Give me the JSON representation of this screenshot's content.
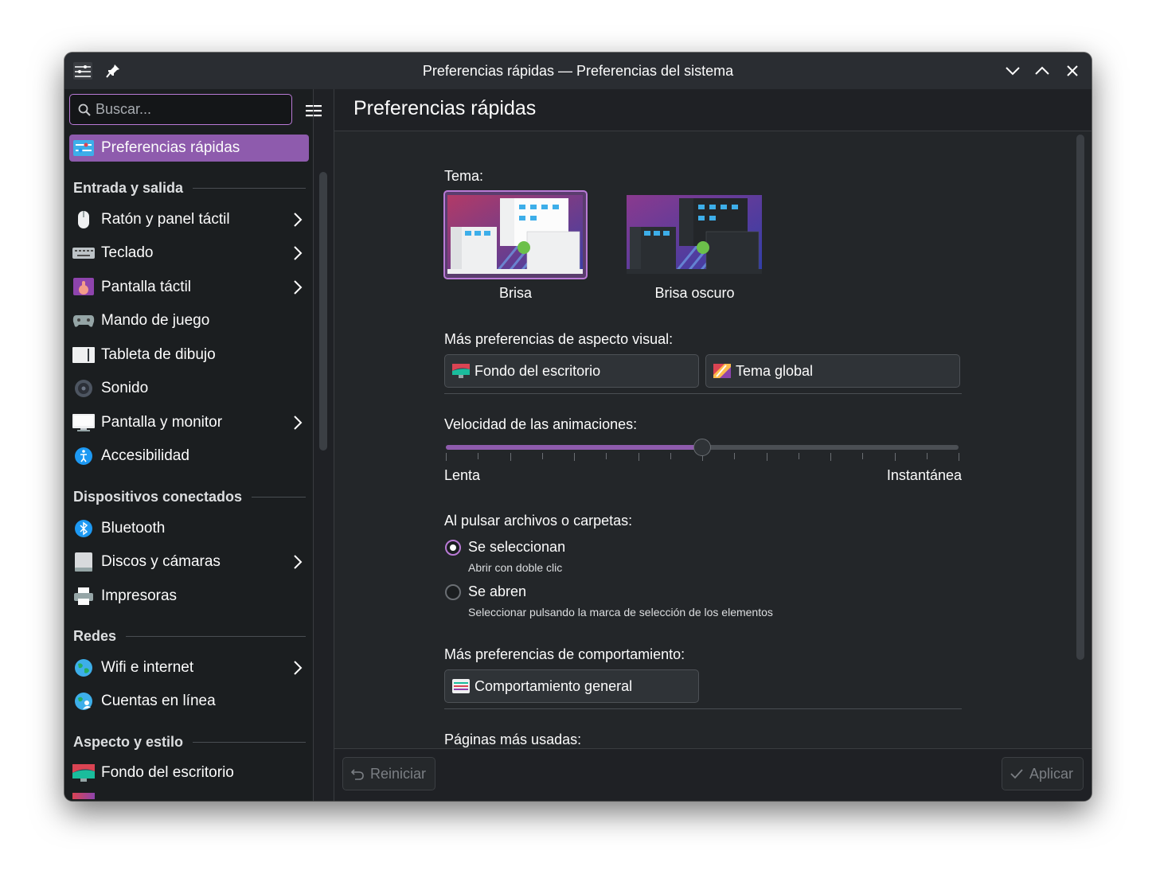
{
  "window": {
    "title": "Preferencias rápidas — Preferencias del sistema",
    "accent": "#8e5bad"
  },
  "search": {
    "placeholder": "Buscar..."
  },
  "sidebar": {
    "active": {
      "label": "Preferencias rápidas",
      "icon": "quick-settings-icon"
    },
    "sections": [
      {
        "title": "Entrada y salida",
        "items": [
          {
            "label": "Ratón y panel táctil",
            "icon": "mouse-icon",
            "chevron": true
          },
          {
            "label": "Teclado",
            "icon": "keyboard-icon",
            "chevron": true
          },
          {
            "label": "Pantalla táctil",
            "icon": "touchscreen-icon",
            "chevron": true
          },
          {
            "label": "Mando de juego",
            "icon": "gamepad-icon",
            "chevron": false
          },
          {
            "label": "Tableta de dibujo",
            "icon": "tablet-icon",
            "chevron": false
          },
          {
            "label": "Sonido",
            "icon": "speaker-icon",
            "chevron": false
          },
          {
            "label": "Pantalla y monitor",
            "icon": "monitor-icon",
            "chevron": true
          },
          {
            "label": "Accesibilidad",
            "icon": "accessibility-icon",
            "chevron": false
          }
        ]
      },
      {
        "title": "Dispositivos conectados",
        "items": [
          {
            "label": "Bluetooth",
            "icon": "bluetooth-icon",
            "chevron": false
          },
          {
            "label": "Discos y cámaras",
            "icon": "disk-icon",
            "chevron": true
          },
          {
            "label": "Impresoras",
            "icon": "printer-icon",
            "chevron": false
          }
        ]
      },
      {
        "title": "Redes",
        "items": [
          {
            "label": "Wifi e internet",
            "icon": "globe-icon",
            "chevron": true
          },
          {
            "label": "Cuentas en línea",
            "icon": "online-accounts-icon",
            "chevron": false
          }
        ]
      },
      {
        "title": "Aspecto y estilo",
        "items": [
          {
            "label": "Fondo del escritorio",
            "icon": "wallpaper-icon",
            "chevron": false
          }
        ]
      }
    ]
  },
  "main": {
    "title": "Preferencias rápidas",
    "theme": {
      "label": "Tema:",
      "options": [
        {
          "name": "Brisa",
          "selected": true
        },
        {
          "name": "Brisa oscuro",
          "selected": false
        }
      ]
    },
    "appearance": {
      "label": "Más preferencias de aspecto visual:",
      "buttons": [
        "Fondo del escritorio",
        "Tema global"
      ]
    },
    "animation": {
      "label": "Velocidad de las animaciones:",
      "min_label": "Lenta",
      "max_label": "Instantánea",
      "value_fraction": 0.5,
      "ticks": 17
    },
    "click": {
      "label": "Al pulsar archivos o carpetas:",
      "options": [
        {
          "label": "Se seleccionan",
          "sub": "Abrir con doble clic",
          "checked": true
        },
        {
          "label": "Se abren",
          "sub": "Seleccionar pulsando la marca de selección de los elementos",
          "checked": false
        }
      ]
    },
    "behavior": {
      "label": "Más preferencias de comportamiento:",
      "button": "Comportamiento general"
    },
    "most_used": {
      "label": "Páginas más usadas:"
    }
  },
  "footer": {
    "reset": "Reiniciar",
    "apply": "Aplicar"
  }
}
